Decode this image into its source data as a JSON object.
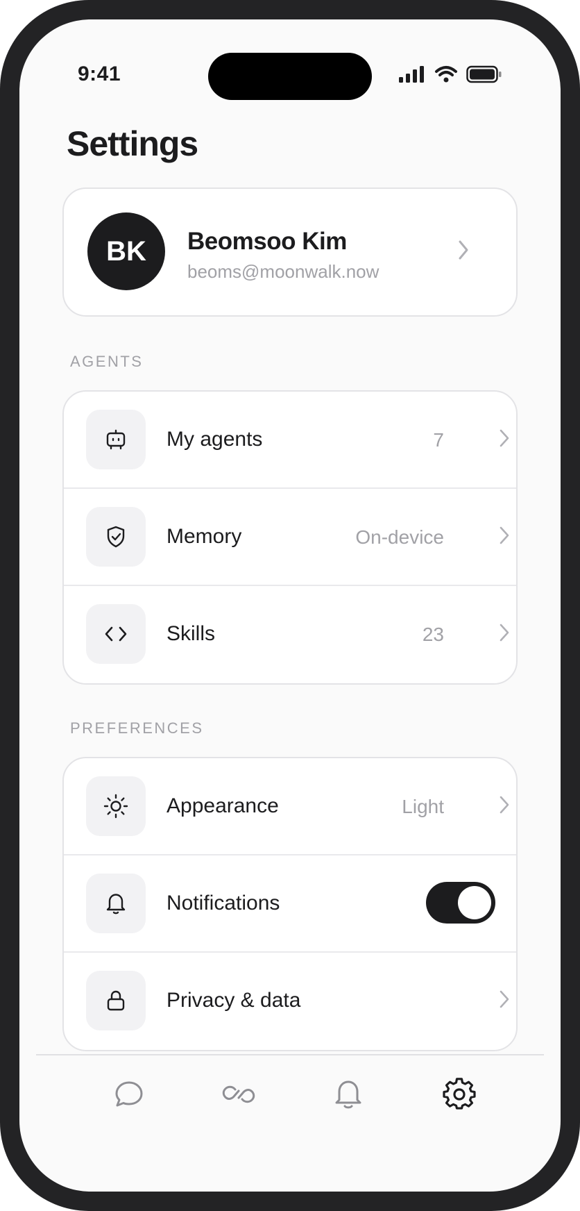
{
  "status_bar": {
    "time": "9:41",
    "icons": [
      "cellular-signal-icon",
      "wifi-icon",
      "battery-icon"
    ]
  },
  "page": {
    "title": "Settings"
  },
  "profile": {
    "initials": "BK",
    "name": "Beomsoo Kim",
    "email": "beoms@moonwalk.now"
  },
  "sections": {
    "agents": {
      "label": "AGENTS",
      "items": [
        {
          "label": "My agents",
          "value": "7",
          "icon": "robot-icon"
        },
        {
          "label": "Memory",
          "value": "On-device",
          "icon": "shield-check-icon"
        },
        {
          "label": "Skills",
          "value": "23",
          "icon": "code-icon"
        }
      ]
    },
    "preferences": {
      "label": "PREFERENCES",
      "items": [
        {
          "label": "Appearance",
          "value": "Light",
          "icon": "sun-icon"
        },
        {
          "label": "Notifications",
          "toggle_on": true,
          "icon": "bell-icon"
        },
        {
          "label": "Privacy & data",
          "icon": "lock-icon"
        }
      ]
    }
  },
  "tab_bar": {
    "tabs": [
      {
        "icon": "chat-bubble-icon",
        "active": false
      },
      {
        "icon": "link-icon",
        "active": false
      },
      {
        "icon": "bell-icon",
        "active": false
      },
      {
        "icon": "gear-icon",
        "active": true
      }
    ]
  },
  "colors": {
    "accent": "#1c1c1e",
    "secondary_text": "#a1a1a6",
    "background": "#fafafa",
    "card": "#ffffff",
    "frame": "#232325"
  }
}
